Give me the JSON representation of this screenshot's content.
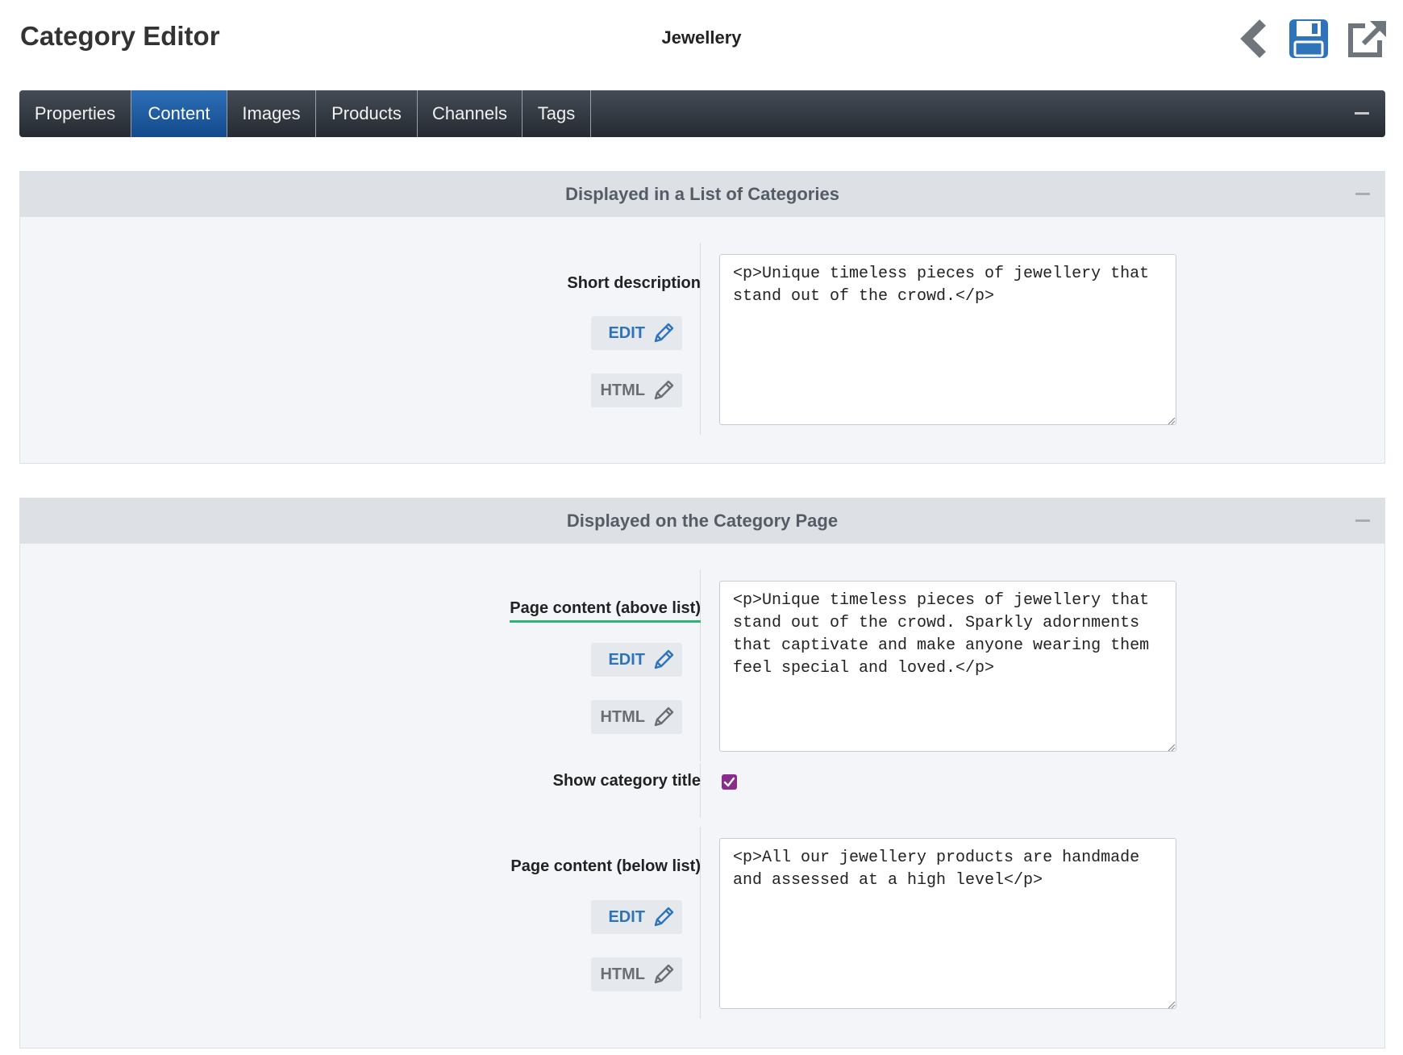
{
  "header": {
    "title": "Category Editor",
    "category_name": "Jewellery"
  },
  "tabs": [
    {
      "label": "Properties",
      "active": false
    },
    {
      "label": "Content",
      "active": true
    },
    {
      "label": "Images",
      "active": false
    },
    {
      "label": "Products",
      "active": false
    },
    {
      "label": "Channels",
      "active": false
    },
    {
      "label": "Tags",
      "active": false
    }
  ],
  "colors": {
    "tab_active": "#1f5da1",
    "edit_blue": "#2f74b9",
    "checkbox_purple": "#8a2b8e",
    "focus_underline": "#2bb673",
    "save_icon_blue": "#2f74b9"
  },
  "icons": {
    "back": "chevron-left-icon",
    "save": "floppy-disk-icon",
    "open": "external-link-icon",
    "edit": "pencil-icon"
  },
  "section_list": {
    "title": "Displayed in a List of Categories",
    "short_description": {
      "label": "Short description",
      "edit_label": "EDIT",
      "html_label": "HTML",
      "value": "<p>Unique timeless pieces of jewellery that stand out of the crowd.</p>"
    }
  },
  "section_page": {
    "title": "Displayed on the Category Page",
    "content_above": {
      "label": "Page content (above list)",
      "edit_label": "EDIT",
      "html_label": "HTML",
      "value": "<p>Unique timeless pieces of jewellery that stand out of the crowd. Sparkly adornments that captivate and make anyone wearing them feel special and loved.</p>"
    },
    "show_title": {
      "label": "Show category title",
      "checked": true
    },
    "content_below": {
      "label": "Page content (below list)",
      "edit_label": "EDIT",
      "html_label": "HTML",
      "value": "<p>All our jewellery products are handmade and assessed at a high level</p>"
    }
  }
}
